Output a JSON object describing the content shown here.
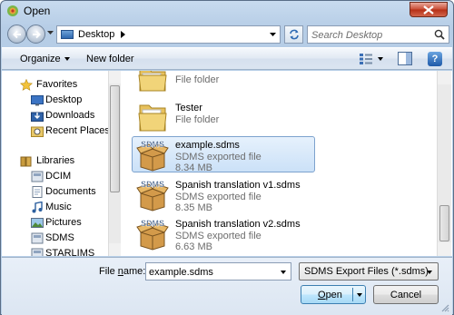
{
  "window": {
    "title": "Open"
  },
  "address": {
    "location": "Desktop"
  },
  "search": {
    "placeholder": "Search Desktop"
  },
  "toolbar": {
    "organize_label": "Organize",
    "new_folder_label": "New folder"
  },
  "nav": {
    "favorites_label": "Favorites",
    "favorites": [
      "Desktop",
      "Downloads",
      "Recent Places"
    ],
    "libraries_label": "Libraries",
    "libraries": [
      "DCIM",
      "Documents",
      "Music",
      "Pictures",
      "SDMS",
      "STARLIMS"
    ]
  },
  "files": [
    {
      "name": "",
      "type": "File folder",
      "size": ""
    },
    {
      "name": "Tester",
      "type": "File folder",
      "size": ""
    },
    {
      "name": "example.sdms",
      "type": "SDMS exported file",
      "size": "8.34 MB"
    },
    {
      "name": "Spanish translation v1.sdms",
      "type": "SDMS exported file",
      "size": "8.35 MB"
    },
    {
      "name": "Spanish translation v2.sdms",
      "type": "SDMS exported file",
      "size": "6.63 MB"
    }
  ],
  "icons": {
    "folder": "folder-icon",
    "sdms_file": "sdms-package-icon",
    "sdms_badge": "SDMS"
  },
  "bottom": {
    "file_name_label_prefix": "File ",
    "file_name_label_underlined": "n",
    "file_name_label_suffix": "ame:",
    "file_name_value": "example.sdms",
    "file_type_value": "SDMS Export Files (*.sdms)",
    "open_label_underlined": "O",
    "open_label_rest": "pen",
    "cancel_label": "Cancel"
  }
}
